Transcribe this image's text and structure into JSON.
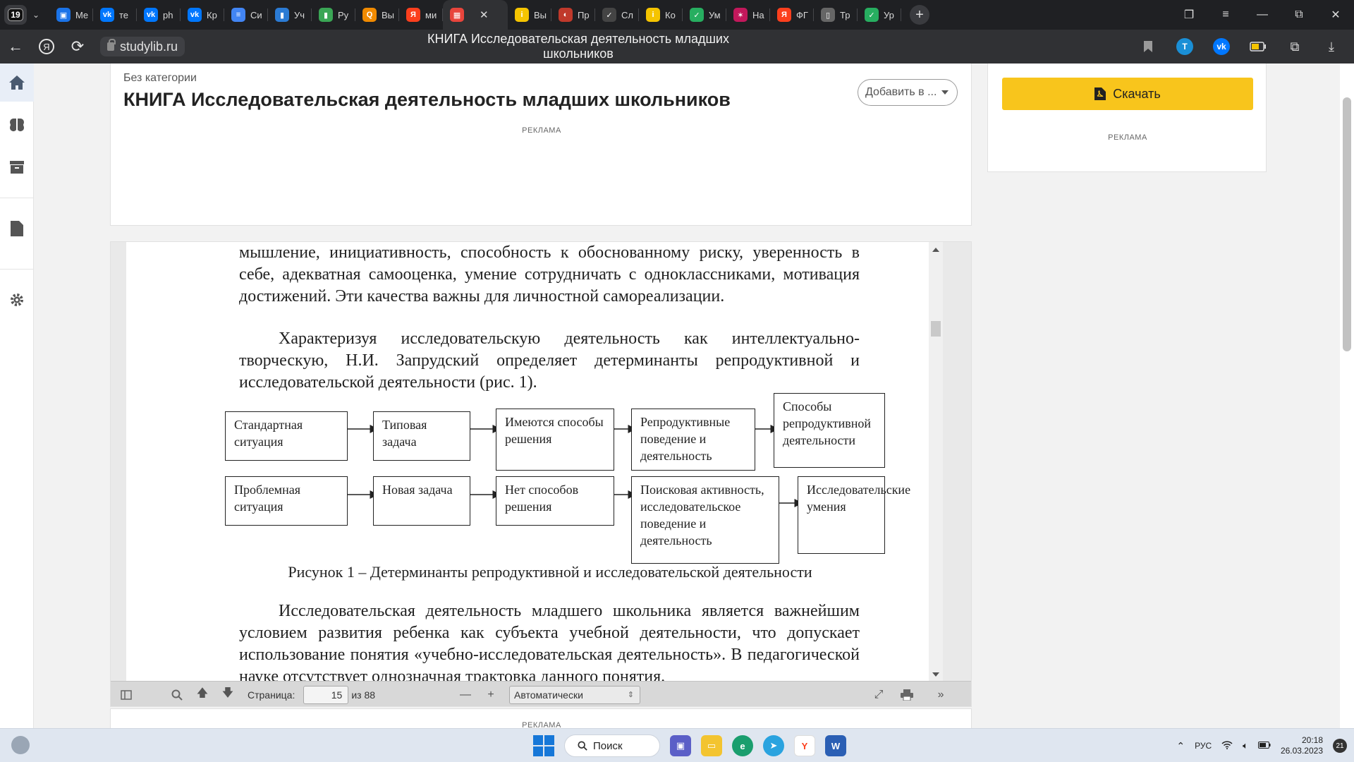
{
  "tabbar": {
    "counter": "19",
    "tabs": [
      {
        "label": "Me",
        "icon": "message-icon",
        "color": "#1a73e8"
      },
      {
        "label": "те",
        "icon": "vk-icon",
        "color": "#0077ff"
      },
      {
        "label": "ph",
        "icon": "vk-icon",
        "color": "#0077ff"
      },
      {
        "label": "Кр",
        "icon": "vk-icon",
        "color": "#0077ff"
      },
      {
        "label": "Си",
        "icon": "docs-icon",
        "color": "#4285f4"
      },
      {
        "label": "Уч",
        "icon": "book-icon",
        "color": "#2b7bd4"
      },
      {
        "label": "Ру",
        "icon": "book-green-icon",
        "color": "#3aa655"
      },
      {
        "label": "Вы",
        "icon": "q-icon",
        "color": "#f08a00"
      },
      {
        "label": "ми",
        "icon": "yandex-icon",
        "color": "#fc3f1d"
      },
      {
        "label": "",
        "icon": "studylib-icon",
        "color": "#e8453c",
        "active": true
      },
      {
        "label": "Вы",
        "icon": "info-icon",
        "color": "#f5c400"
      },
      {
        "label": "Пр",
        "icon": "flag-icon",
        "color": "#c0392b"
      },
      {
        "label": "Сл",
        "icon": "check-icon",
        "color": "#444"
      },
      {
        "label": "Ко",
        "icon": "info-icon",
        "color": "#f5c400"
      },
      {
        "label": "Ум",
        "icon": "checkmark-icon",
        "color": "#27ae60"
      },
      {
        "label": "На",
        "icon": "star-icon",
        "color": "#c2185b"
      },
      {
        "label": "ФГ",
        "icon": "yandex-icon",
        "color": "#fc3f1d"
      },
      {
        "label": "Тр",
        "icon": "file-icon",
        "color": "#666"
      },
      {
        "label": "Ур",
        "icon": "checkmark-icon",
        "color": "#27ae60"
      }
    ]
  },
  "addressbar": {
    "url": "studylib.ru",
    "page_title": "КНИГА Исследовательская деятельность младших школьников"
  },
  "header": {
    "breadcrumb": "Без категории",
    "title": "КНИГА Исследовательская деятельность младших школьников",
    "add_to": "Добавить в ...",
    "ad_label": "РЕКЛАМА"
  },
  "sidebar": {
    "download_label": "Скачать",
    "ad_label": "РЕКЛАМА",
    "accent": "#f8c51c"
  },
  "pdf": {
    "paragraph_top": "мышление, инициативность, способность к обоснованному риску, уверенность в себе, адекватная самооценка, умение сотрудничать с одноклассниками, мотивация достижений. Эти качества важны для личностной самореализации.",
    "paragraph_mid": "Характеризуя исследовательскую деятельность как интеллектуально-творческую, Н.И. Запрудский определяет детерминанты репродуктивной и исследовательской деятельности (рис. 1).",
    "flow_row1": [
      "Стандартная ситуация",
      "Типовая задача",
      "Имеются способы решения",
      "Репродуктивные поведение и деятельность",
      "Способы репродуктивной деятельности"
    ],
    "flow_row2": [
      "Проблемная ситуация",
      "Новая задача",
      "Нет способов решения",
      "Поисковая активность, исследовательское поведение и деятельность",
      "Исследовательские умения"
    ],
    "caption": "Рисунок 1 – Детерминанты репродуктивной и исследовательской деятельности",
    "paragraph_bottom": "Исследовательская деятельность младшего школьника является важнейшим условием развития ребенка как субъекта учебной деятельности, что допускает использование понятия «учебно-исследовательская деятельность». В педагогической науке отсутствует однозначная трактовка данного понятия."
  },
  "pdf_toolbar": {
    "page_label": "Страница:",
    "page_value": "15",
    "page_total": "из 88",
    "zoom": "Автоматически"
  },
  "bottom_ad": "РЕКЛАМА",
  "taskbar": {
    "search_label": "Поиск",
    "lang": "РУС",
    "time": "20:18",
    "date": "26.03.2023",
    "notifications": "21"
  }
}
